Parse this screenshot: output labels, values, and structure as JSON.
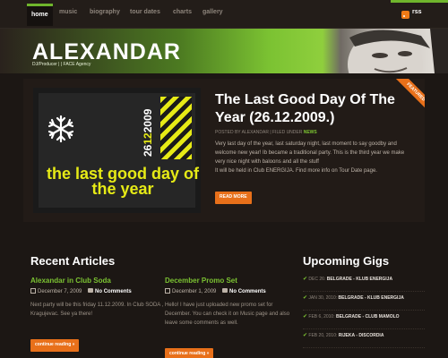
{
  "nav": {
    "items": [
      {
        "label": "home",
        "active": true
      },
      {
        "label": "music",
        "active": false
      },
      {
        "label": "biography",
        "active": false
      },
      {
        "label": "tour dates",
        "active": false
      },
      {
        "label": "charts",
        "active": false
      },
      {
        "label": "gallery",
        "active": false
      }
    ],
    "rss_label": "rss",
    "rss_icon": "rss-icon"
  },
  "header": {
    "logo": "ALEXANDAR",
    "tagline": "DJ/Producer | | FACE Agency"
  },
  "featured": {
    "ribbon": "FEATURED",
    "title": "The Last Good Day Of The Year (26.12.2009.)",
    "meta_prefix": "POSTED BY ALEXANDAR | FILED UNDER",
    "meta_category": "NEWS",
    "body_line1": "Very last day of the year, last saturday night, last moment to say goodby and welcome new year! Ib became a traditional party. This is the third year we make very nice night with baloons and all the stuff",
    "body_line2": "It will be held in Club ENERGIJA. Find more info on Tour Date page.",
    "read_more": "READ MORE",
    "poster": {
      "date": "26122009",
      "date_white": "26",
      "date_yellow": "12",
      "date_white2": "2009",
      "text": "the last good day of the year"
    }
  },
  "recent": {
    "title": "Recent Articles",
    "articles": [
      {
        "title": "Alexandar in Club Soda",
        "date": "December 7, 2009",
        "comments": "No Comments",
        "body": "Next party will be this friday 11.12.2009. In Club SODA , Kragujevac. See ya there!",
        "button": "continue reading »"
      },
      {
        "title": "December Promo Set",
        "date": "December 1, 2009",
        "comments": "No Comments",
        "body": "Hello! I have just uploaded new promo set for December. You can check it on Music page and also leave some comments as well.",
        "button": "continue reading »"
      }
    ]
  },
  "gigs": {
    "title": "Upcoming Gigs",
    "items": [
      {
        "date": "DEC 26:",
        "venue": "BELGRADE - KLUB ENERGIJA"
      },
      {
        "date": "JAN 30, 2010:",
        "venue": "BELGRADE - KLUB ENERGIJA"
      },
      {
        "date": "FEB 6, 2010:",
        "venue": "BELGRADE - CLUB MAMOLO"
      },
      {
        "date": "FEB 20, 2010:",
        "venue": "RIJEKA - DISCORDIA"
      }
    ]
  },
  "colors": {
    "accent_green": "#7bc232",
    "accent_orange": "#e8701a",
    "background": "#1c1714",
    "poster_yellow": "#e6ea16"
  }
}
